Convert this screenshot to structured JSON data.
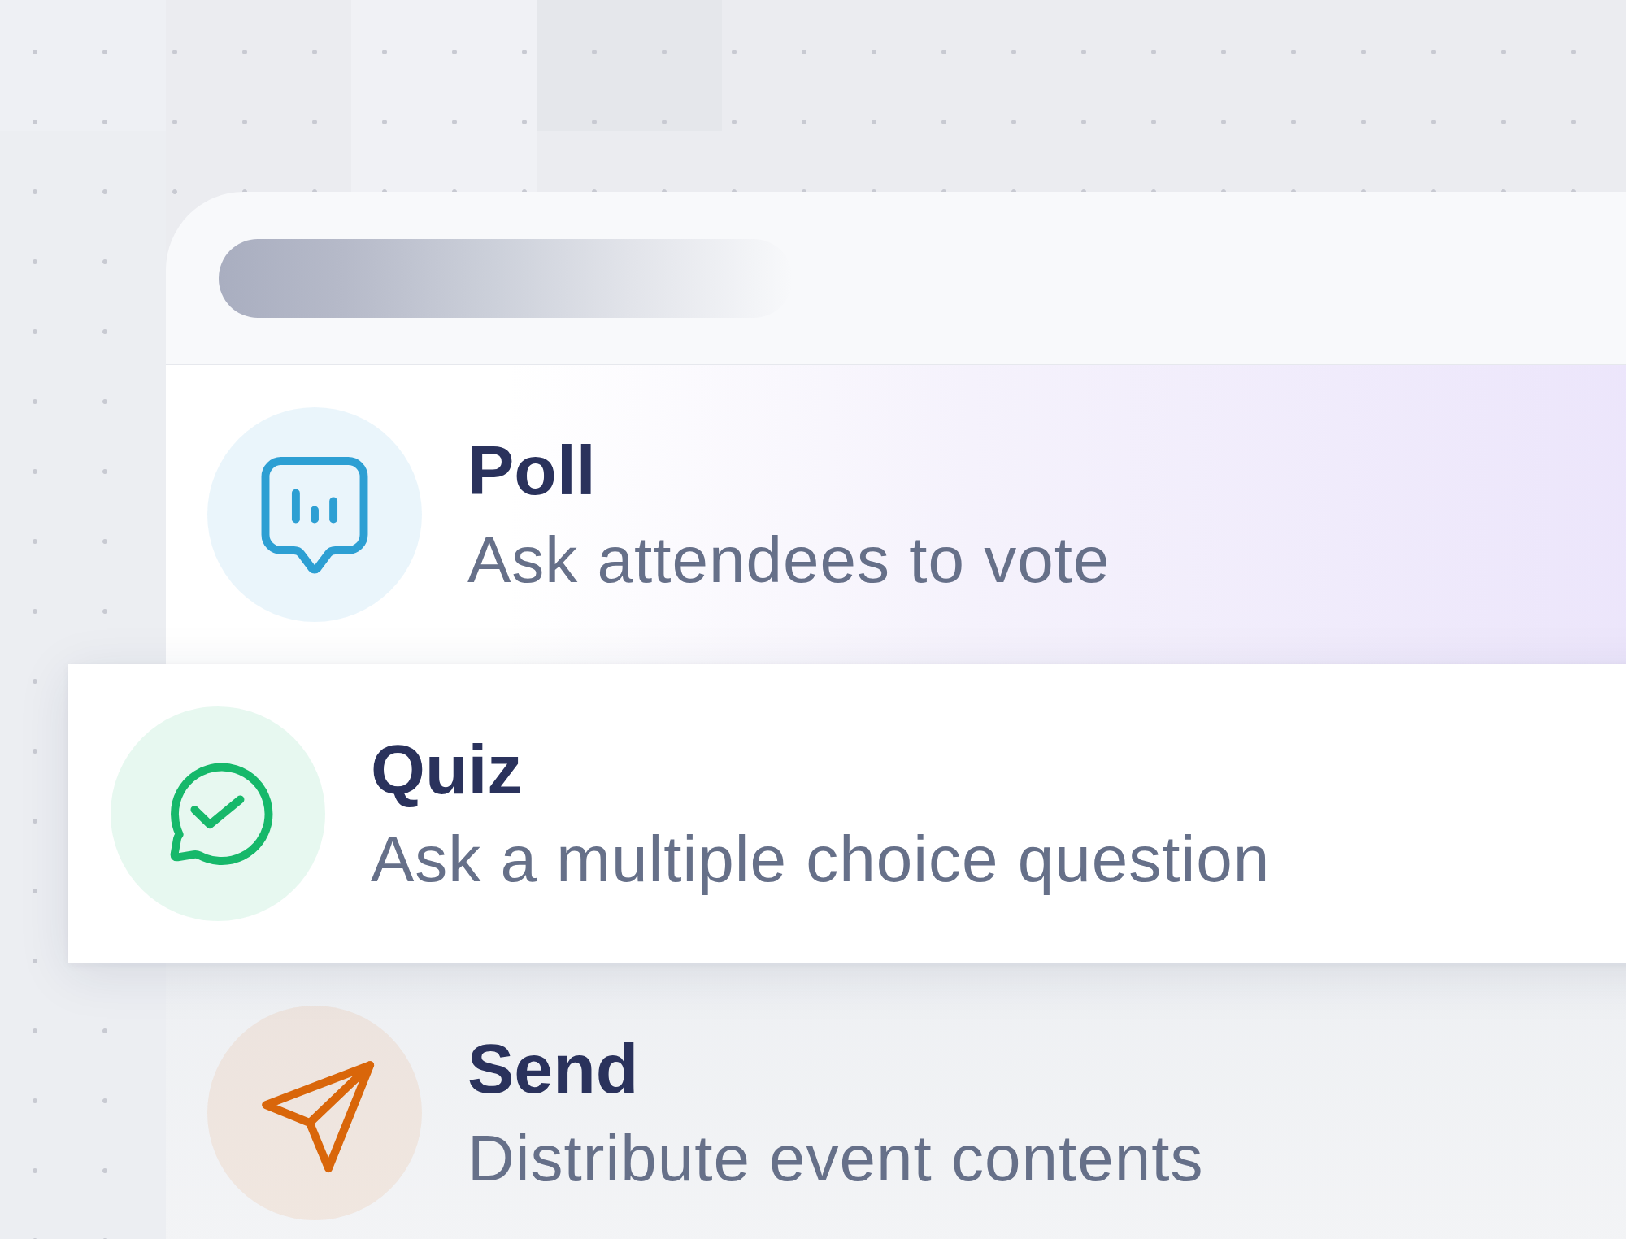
{
  "menu": {
    "options": [
      {
        "title": "Poll",
        "description": "Ask attendees to vote",
        "color": "#2d9fd3",
        "highlighted": true,
        "selected": false,
        "dimmed": false
      },
      {
        "title": "Quiz",
        "description": "Ask a multiple choice question",
        "color": "#16b86a",
        "highlighted": false,
        "selected": true,
        "dimmed": false
      },
      {
        "title": "Send",
        "description": "Distribute event contents",
        "color": "#d9660a",
        "highlighted": false,
        "selected": false,
        "dimmed": true
      }
    ]
  }
}
